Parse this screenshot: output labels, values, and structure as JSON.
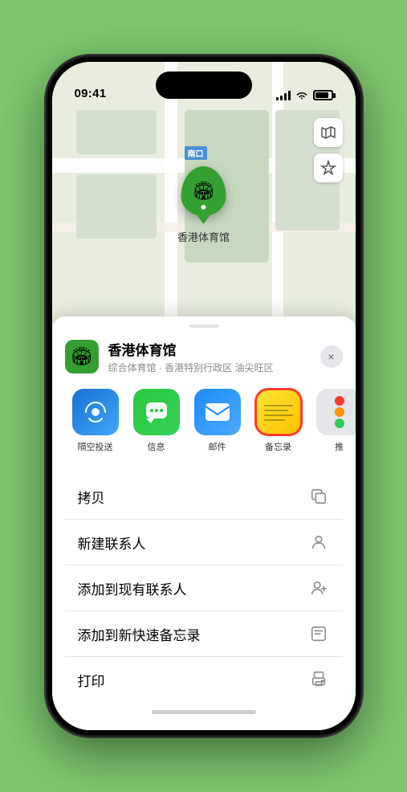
{
  "status_bar": {
    "time": "09:41",
    "signal_label": "signal",
    "wifi_label": "wifi",
    "battery_label": "battery"
  },
  "map": {
    "label_box": "南口",
    "venue_name_pin": "香港体育馆",
    "map_type_icon": "map-icon",
    "location_icon": "location-arrow-icon"
  },
  "bottom_sheet": {
    "venue_icon": "🏟",
    "venue_name": "香港体育馆",
    "venue_desc": "综合体育馆 · 香港特别行政区 油尖旺区",
    "close_label": "×",
    "share_items": [
      {
        "id": "airdrop",
        "icon": "📡",
        "label": "隔空投送",
        "type": "airdrop"
      },
      {
        "id": "messages",
        "icon": "💬",
        "label": "信息",
        "type": "messages"
      },
      {
        "id": "mail",
        "icon": "✉",
        "label": "邮件",
        "type": "mail"
      },
      {
        "id": "notes",
        "icon": "notes",
        "label": "备忘录",
        "type": "notes"
      },
      {
        "id": "more",
        "icon": "more",
        "label": "推",
        "type": "more"
      }
    ],
    "actions": [
      {
        "id": "copy",
        "label": "拷贝",
        "icon": "copy"
      },
      {
        "id": "new-contact",
        "label": "新建联系人",
        "icon": "person"
      },
      {
        "id": "add-existing",
        "label": "添加到现有联系人",
        "icon": "person-add"
      },
      {
        "id": "add-notes",
        "label": "添加到新快速备忘录",
        "icon": "notes-add"
      },
      {
        "id": "print",
        "label": "打印",
        "icon": "print"
      }
    ]
  }
}
